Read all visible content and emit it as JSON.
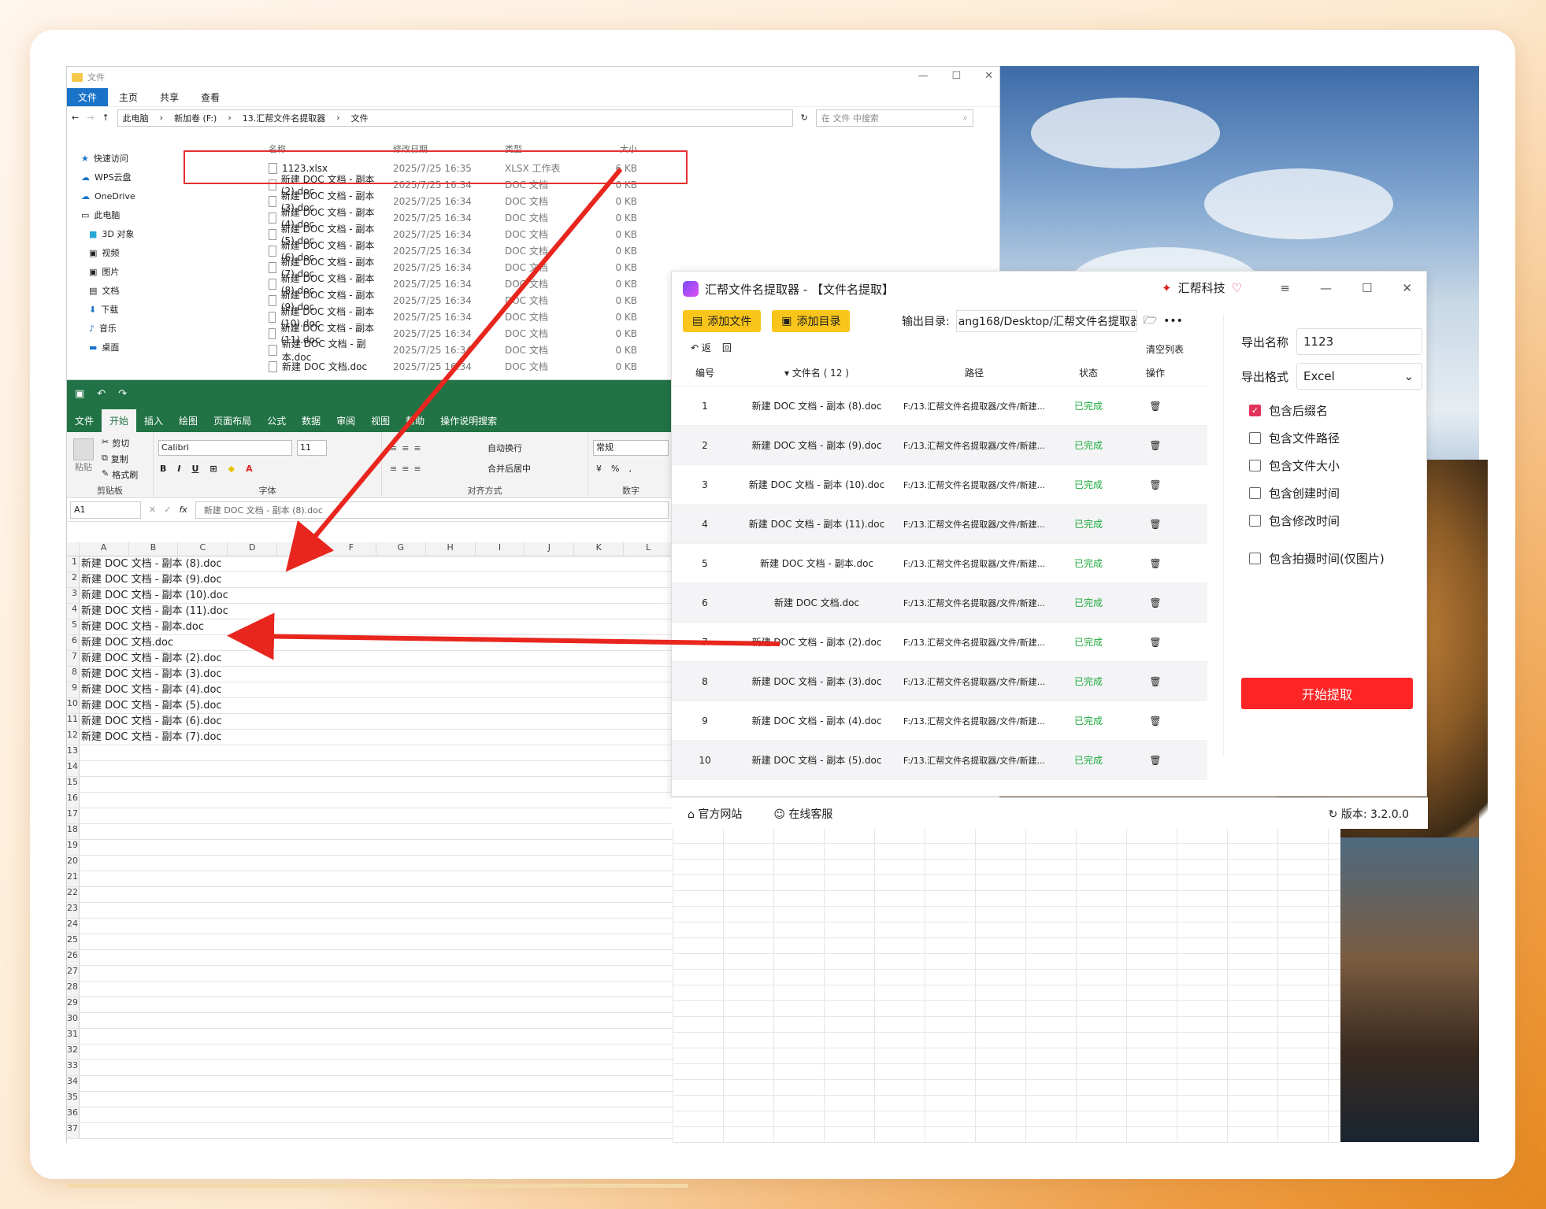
{
  "explorer": {
    "title": "文件",
    "tabs": [
      "文件",
      "主页",
      "共享",
      "查看"
    ],
    "path": [
      "此电脑",
      "新加卷 (F:)",
      "13.汇帮文件名提取器",
      "文件"
    ],
    "search_placeholder": "在 文件 中搜索",
    "nav": [
      "快速访问",
      "WPS云盘",
      "OneDrive",
      "此电脑",
      "3D 对象",
      "视频",
      "图片",
      "文档",
      "下载",
      "音乐",
      "桌面"
    ],
    "columns": [
      "名称",
      "修改日期",
      "类型",
      "大小"
    ],
    "files": [
      {
        "name": "1123.xlsx",
        "date": "2025/7/25 16:35",
        "type": "XLSX 工作表",
        "size": "6 KB"
      },
      {
        "name": "新建 DOC 文档 - 副本 (2).doc",
        "date": "2025/7/25 16:34",
        "type": "DOC 文档",
        "size": "0 KB"
      },
      {
        "name": "新建 DOC 文档 - 副本 (3).doc",
        "date": "2025/7/25 16:34",
        "type": "DOC 文档",
        "size": "0 KB"
      },
      {
        "name": "新建 DOC 文档 - 副本 (4).doc",
        "date": "2025/7/25 16:34",
        "type": "DOC 文档",
        "size": "0 KB"
      },
      {
        "name": "新建 DOC 文档 - 副本 (5).doc",
        "date": "2025/7/25 16:34",
        "type": "DOC 文档",
        "size": "0 KB"
      },
      {
        "name": "新建 DOC 文档 - 副本 (6).doc",
        "date": "2025/7/25 16:34",
        "type": "DOC 文档",
        "size": "0 KB"
      },
      {
        "name": "新建 DOC 文档 - 副本 (7).doc",
        "date": "2025/7/25 16:34",
        "type": "DOC 文档",
        "size": "0 KB"
      },
      {
        "name": "新建 DOC 文档 - 副本 (8).doc",
        "date": "2025/7/25 16:34",
        "type": "DOC 文档",
        "size": "0 KB"
      },
      {
        "name": "新建 DOC 文档 - 副本 (9).doc",
        "date": "2025/7/25 16:34",
        "type": "DOC 文档",
        "size": "0 KB"
      },
      {
        "name": "新建 DOC 文档 - 副本 (10).doc",
        "date": "2025/7/25 16:34",
        "type": "DOC 文档",
        "size": "0 KB"
      },
      {
        "name": "新建 DOC 文档 - 副本 (11).doc",
        "date": "2025/7/25 16:34",
        "type": "DOC 文档",
        "size": "0 KB"
      },
      {
        "name": "新建 DOC 文档 - 副本.doc",
        "date": "2025/7/25 16:34",
        "type": "DOC 文档",
        "size": "0 KB"
      },
      {
        "name": "新建 DOC 文档.doc",
        "date": "2025/7/25 16:34",
        "type": "DOC 文档",
        "size": "0 KB"
      }
    ]
  },
  "excel": {
    "tabs": [
      "文件",
      "开始",
      "插入",
      "绘图",
      "页面布局",
      "公式",
      "数据",
      "审阅",
      "视图",
      "帮助",
      "操作说明搜索"
    ],
    "clipboard": {
      "paste": "粘贴",
      "cut": "剪切",
      "copy": "复制",
      "painter": "格式刷",
      "label": "剪贴板"
    },
    "font": {
      "name": "Calibri",
      "size": "11",
      "label": "字体"
    },
    "align": {
      "wrap": "自动换行",
      "merge": "合并后居中",
      "label": "对齐方式"
    },
    "number": {
      "format": "常规",
      "label": "数字"
    },
    "cell_ref": "A1",
    "formula": "新建 DOC 文档 - 副本 (8).doc",
    "columns": [
      "A",
      "B",
      "C",
      "D",
      "E",
      "F",
      "G",
      "H",
      "I",
      "J",
      "K",
      "L"
    ],
    "cells": [
      "新建 DOC 文档 - 副本 (8).doc",
      "新建 DOC 文档 - 副本 (9).doc",
      "新建 DOC 文档 - 副本 (10).doc",
      "新建 DOC 文档 - 副本 (11).doc",
      "新建 DOC 文档 - 副本.doc",
      "新建 DOC 文档.doc",
      "新建 DOC 文档 - 副本 (2).doc",
      "新建 DOC 文档 - 副本 (3).doc",
      "新建 DOC 文档 - 副本 (4).doc",
      "新建 DOC 文档 - 副本 (5).doc",
      "新建 DOC 文档 - 副本 (6).doc",
      "新建 DOC 文档 - 副本 (7).doc"
    ]
  },
  "app": {
    "title": "汇帮文件名提取器 - 【文件名提取】",
    "brand": "汇帮科技",
    "add_file": "添加文件",
    "add_dir": "添加目录",
    "output_label": "输出目录:",
    "output_path": "ang168/Desktop/汇帮文件名提取器",
    "undo": "返",
    "redo": "回",
    "clear": "清空列表",
    "headers": [
      "编号",
      "文件名 ( 12 )",
      "路径",
      "状态",
      "操作"
    ],
    "rows": [
      {
        "no": "1",
        "name": "新建 DOC 文档 - 副本 (8).doc",
        "path": "F:/13.汇帮文件名提取器/文件/新建...",
        "status": "已完成"
      },
      {
        "no": "2",
        "name": "新建 DOC 文档 - 副本 (9).doc",
        "path": "F:/13.汇帮文件名提取器/文件/新建...",
        "status": "已完成"
      },
      {
        "no": "3",
        "name": "新建 DOC 文档 - 副本 (10).doc",
        "path": "F:/13.汇帮文件名提取器/文件/新建...",
        "status": "已完成"
      },
      {
        "no": "4",
        "name": "新建 DOC 文档 - 副本 (11).doc",
        "path": "F:/13.汇帮文件名提取器/文件/新建...",
        "status": "已完成"
      },
      {
        "no": "5",
        "name": "新建 DOC 文档 - 副本.doc",
        "path": "F:/13.汇帮文件名提取器/文件/新建...",
        "status": "已完成"
      },
      {
        "no": "6",
        "name": "新建 DOC 文档.doc",
        "path": "F:/13.汇帮文件名提取器/文件/新建...",
        "status": "已完成"
      },
      {
        "no": "7",
        "name": "新建 DOC 文档 - 副本 (2).doc",
        "path": "F:/13.汇帮文件名提取器/文件/新建...",
        "status": "已完成"
      },
      {
        "no": "8",
        "name": "新建 DOC 文档 - 副本 (3).doc",
        "path": "F:/13.汇帮文件名提取器/文件/新建...",
        "status": "已完成"
      },
      {
        "no": "9",
        "name": "新建 DOC 文档 - 副本 (4).doc",
        "path": "F:/13.汇帮文件名提取器/文件/新建...",
        "status": "已完成"
      },
      {
        "no": "10",
        "name": "新建 DOC 文档 - 副本 (5).doc",
        "path": "F:/13.汇帮文件名提取器/文件/新建...",
        "status": "已完成"
      }
    ],
    "export_name_label": "导出名称",
    "export_name_value": "1123",
    "export_format_label": "导出格式",
    "export_format_value": "Excel",
    "options": [
      {
        "label": "包含后缀名",
        "checked": true
      },
      {
        "label": "包含文件路径",
        "checked": false
      },
      {
        "label": "包含文件大小",
        "checked": false
      },
      {
        "label": "包含创建时间",
        "checked": false
      },
      {
        "label": "包含修改时间",
        "checked": false
      },
      {
        "label": "包含拍摄时间(仅图片)",
        "checked": false
      }
    ],
    "start": "开始提取",
    "website": "官方网站",
    "support": "在线客服",
    "version": "版本: 3.2.0.0"
  },
  "colors": {
    "accent_red": "#fc2424",
    "excel_green": "#217346",
    "button_yellow": "#f9c51a",
    "done_green": "#1eaa3c"
  }
}
